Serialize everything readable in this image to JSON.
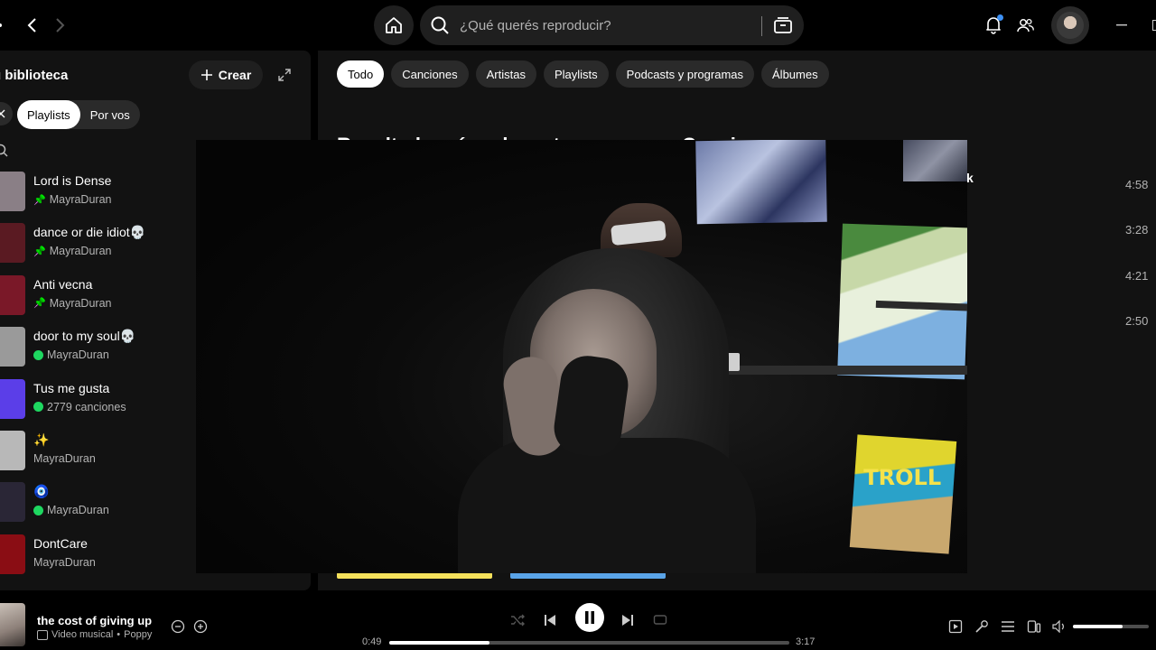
{
  "topbar": {
    "search_placeholder": "¿Qué querés reproducir?",
    "accent_notification": "#3d91f4"
  },
  "sidebar": {
    "title": "u biblioteca",
    "create_label": "Crear",
    "filters": [
      "Playlists",
      "Por vos"
    ],
    "active_filter": "Playlists",
    "items": [
      {
        "name": "Lord is Dense",
        "sub": "MayraDuran",
        "pinned": true,
        "downloaded": false,
        "color": "#8a7f86"
      },
      {
        "name": "dance or die idiot💀",
        "sub": "MayraDuran",
        "pinned": true,
        "downloaded": false,
        "color": "#5a1a22"
      },
      {
        "name": "Anti vecna",
        "sub": "MayraDuran",
        "pinned": true,
        "downloaded": false,
        "color": "#7a1828"
      },
      {
        "name": "door to my soul💀",
        "sub": "MayraDuran",
        "pinned": false,
        "downloaded": true,
        "color": "#9a9a9a"
      },
      {
        "name": "Tus me gusta",
        "sub": "2779 canciones",
        "pinned": false,
        "downloaded": true,
        "color": "#5b3ee8"
      },
      {
        "name": "✨",
        "sub": "MayraDuran",
        "pinned": false,
        "downloaded": false,
        "color": "#b8b8b8"
      },
      {
        "name": "🧿",
        "sub": "MayraDuran",
        "pinned": false,
        "downloaded": true,
        "color": "#2a2636"
      },
      {
        "name": "DontCare",
        "sub": "MayraDuran",
        "pinned": false,
        "downloaded": false,
        "color": "#8a0d14"
      }
    ]
  },
  "main": {
    "tabs": [
      "Todo",
      "Canciones",
      "Artistas",
      "Playlists",
      "Podcasts y programas",
      "Álbumes"
    ],
    "active_tab": "Todo",
    "top_result_heading": "Resultado más relevante",
    "songs_heading": "Canciones",
    "durations": [
      "4:58",
      "3:28",
      "4:21",
      "2:50"
    ],
    "k_letter": "k",
    "card_colors": [
      "#f5e15b",
      "#5aa4e8"
    ]
  },
  "player": {
    "track_title": "the cost of giving up",
    "track_type": "Video musical",
    "track_artist": "Poppy",
    "elapsed": "0:49",
    "total": "3:17",
    "progress_fraction": 0.25,
    "volume_fraction": 0.66,
    "video_poster_text": "TROLL"
  }
}
